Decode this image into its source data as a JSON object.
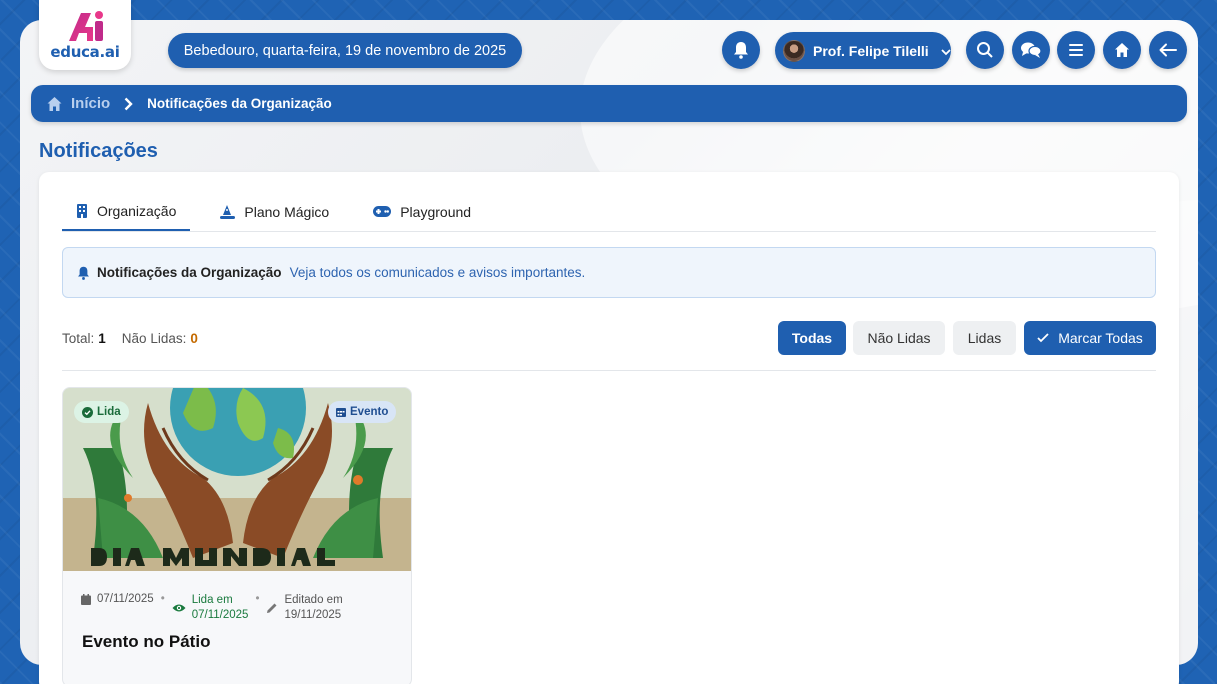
{
  "app": {
    "logo_text": "educa.ai"
  },
  "header": {
    "date_text": "Bebedouro, quarta-feira, 19 de novembro de 2025",
    "user_name": "Prof. Felipe Tilelli"
  },
  "breadcrumb": {
    "home": "Início",
    "current": "Notificações da Organização"
  },
  "page": {
    "title": "Notificações"
  },
  "tabs": [
    {
      "label": "Organização",
      "icon": "building-icon"
    },
    {
      "label": "Plano Mágico",
      "icon": "wizard-hat-icon"
    },
    {
      "label": "Playground",
      "icon": "gamepad-icon"
    }
  ],
  "info": {
    "title": "Notificações da Organização",
    "description": "Veja todos os comunicados e avisos importantes."
  },
  "counts": {
    "total_label": "Total:",
    "total": "1",
    "unread_label": "Não Lidas:",
    "unread": "0"
  },
  "filters": {
    "all": "Todas",
    "unread": "Não Lidas",
    "read": "Lidas",
    "mark_all": "Marcar Todas"
  },
  "notifications": [
    {
      "read_badge": "Lida",
      "type_badge": "Evento",
      "image_text": "DIA MUNDIAL",
      "date": "07/11/2025",
      "read_label": "Lida em",
      "read_date": "07/11/2025",
      "edited_label": "Editado em",
      "edited_date": "19/11/2025",
      "title": "Evento no Pátio"
    }
  ],
  "colors": {
    "primary": "#1f5fb0",
    "unread": "#c46a00",
    "read_green": "#1a7a3e"
  }
}
